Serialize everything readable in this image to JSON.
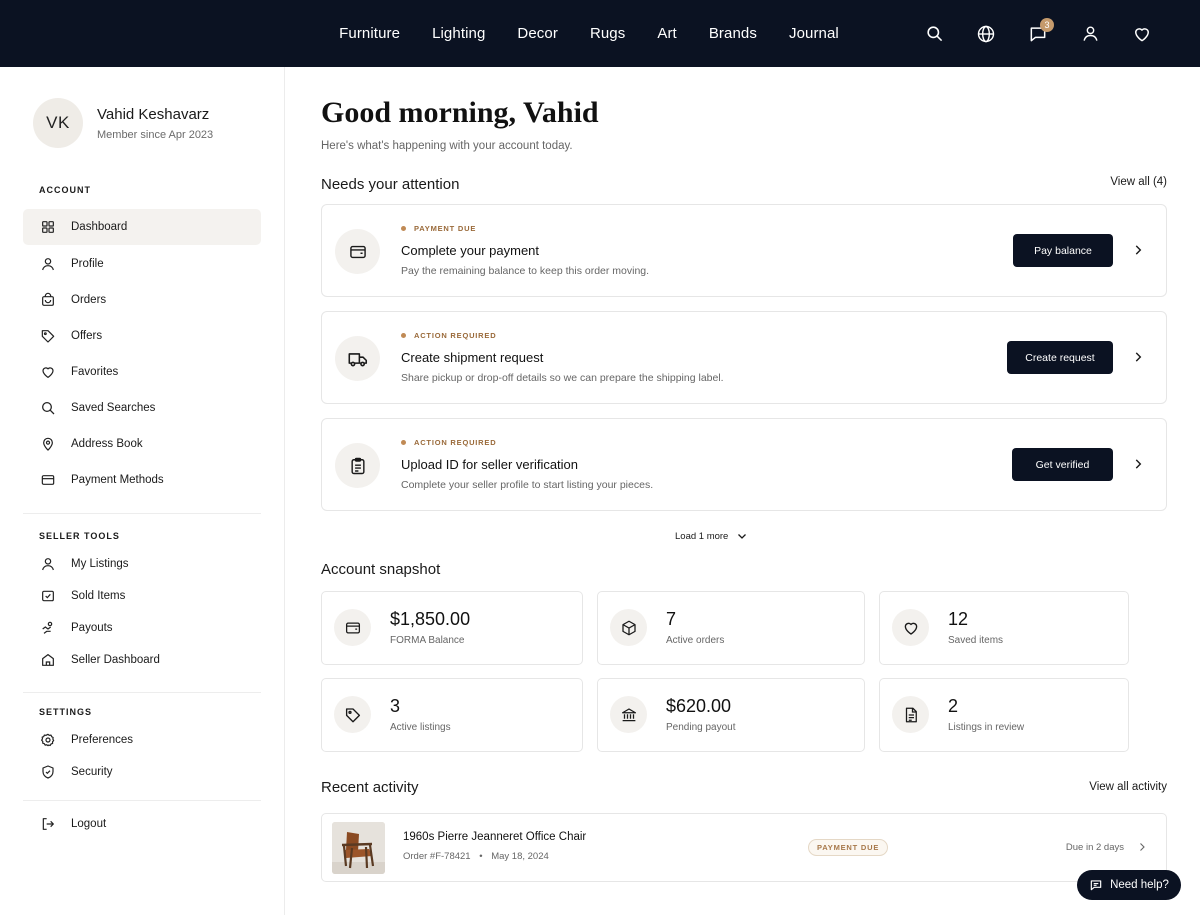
{
  "nav": {
    "links": [
      "Furniture",
      "Lighting",
      "Decor",
      "Rugs",
      "Art",
      "Brands",
      "Journal"
    ],
    "messages_badge": "3",
    "icons": [
      "search-icon",
      "globe-icon",
      "messages-icon",
      "user-icon",
      "heart-icon"
    ]
  },
  "user": {
    "initials": "VK",
    "name": "Vahid Keshavarz",
    "member_since": "Member since Apr 2023"
  },
  "sidebar": {
    "account_title": "ACCOUNT",
    "account_items": [
      {
        "label": "Dashboard",
        "icon": "grid-icon"
      },
      {
        "label": "Profile",
        "icon": "user-icon"
      },
      {
        "label": "Orders",
        "icon": "bag-icon"
      },
      {
        "label": "Offers",
        "icon": "tag-icon"
      },
      {
        "label": "Favorites",
        "icon": "heart-icon"
      },
      {
        "label": "Saved Searches",
        "icon": "search-icon"
      },
      {
        "label": "Address Book",
        "icon": "pin-icon"
      },
      {
        "label": "Payment Methods",
        "icon": "card-icon"
      }
    ],
    "seller_title": "SELLER TOOLS",
    "seller_items": [
      {
        "label": "My Listings",
        "icon": "user-icon"
      },
      {
        "label": "Sold Items",
        "icon": "sold-icon"
      },
      {
        "label": "Payouts",
        "icon": "payout-icon"
      },
      {
        "label": "Seller Dashboard",
        "icon": "store-icon"
      }
    ],
    "settings_title": "SETTINGS",
    "settings_items": [
      {
        "label": "Preferences",
        "icon": "gear-icon"
      },
      {
        "label": "Security",
        "icon": "shield-icon"
      }
    ],
    "logout": "Logout"
  },
  "main": {
    "greeting": "Good morning, Vahid",
    "subtitle": "Here's what's happening with your account today.",
    "attention": {
      "title": "Needs your attention",
      "view_all": "View all (4)",
      "tasks": [
        {
          "tag": "PAYMENT DUE",
          "title": "Complete your payment",
          "desc": "Pay the remaining balance to keep this order moving.",
          "button": "Pay balance",
          "icon": "wallet-icon"
        },
        {
          "tag": "ACTION REQUIRED",
          "title": "Create shipment request",
          "desc": "Share pickup or drop-off details so we can prepare the shipping label.",
          "button": "Create request",
          "icon": "truck-icon"
        },
        {
          "tag": "ACTION REQUIRED",
          "title": "Upload ID for seller verification",
          "desc": "Complete your seller profile to start listing your pieces.",
          "button": "Get verified",
          "icon": "clipboard-icon"
        }
      ],
      "load_more": "Load 1 more"
    },
    "snapshot": {
      "title": "Account snapshot",
      "stats": [
        {
          "value": "$1,850.00",
          "label": "FORMA Balance",
          "icon": "wallet-icon"
        },
        {
          "value": "7",
          "label": "Active orders",
          "icon": "box-icon"
        },
        {
          "value": "12",
          "label": "Saved items",
          "icon": "heart-icon"
        },
        {
          "value": "3",
          "label": "Active listings",
          "icon": "tag-icon"
        },
        {
          "value": "$620.00",
          "label": "Pending payout",
          "icon": "bank-icon"
        },
        {
          "value": "2",
          "label": "Listings in review",
          "icon": "document-icon"
        }
      ]
    },
    "activity": {
      "title": "Recent activity",
      "view_all": "View all activity",
      "items": [
        {
          "title": "1960s Pierre Jeanneret Office Chair",
          "order": "Order #F-78421",
          "date": "May 18, 2024",
          "badge": "PAYMENT DUE",
          "due": "Due in 2 days"
        }
      ]
    }
  },
  "help": {
    "label": "Need help?"
  },
  "colors": {
    "nav_bg": "#0b1222",
    "accent": "#c59a6c",
    "tag_text": "#9a6a3a"
  }
}
